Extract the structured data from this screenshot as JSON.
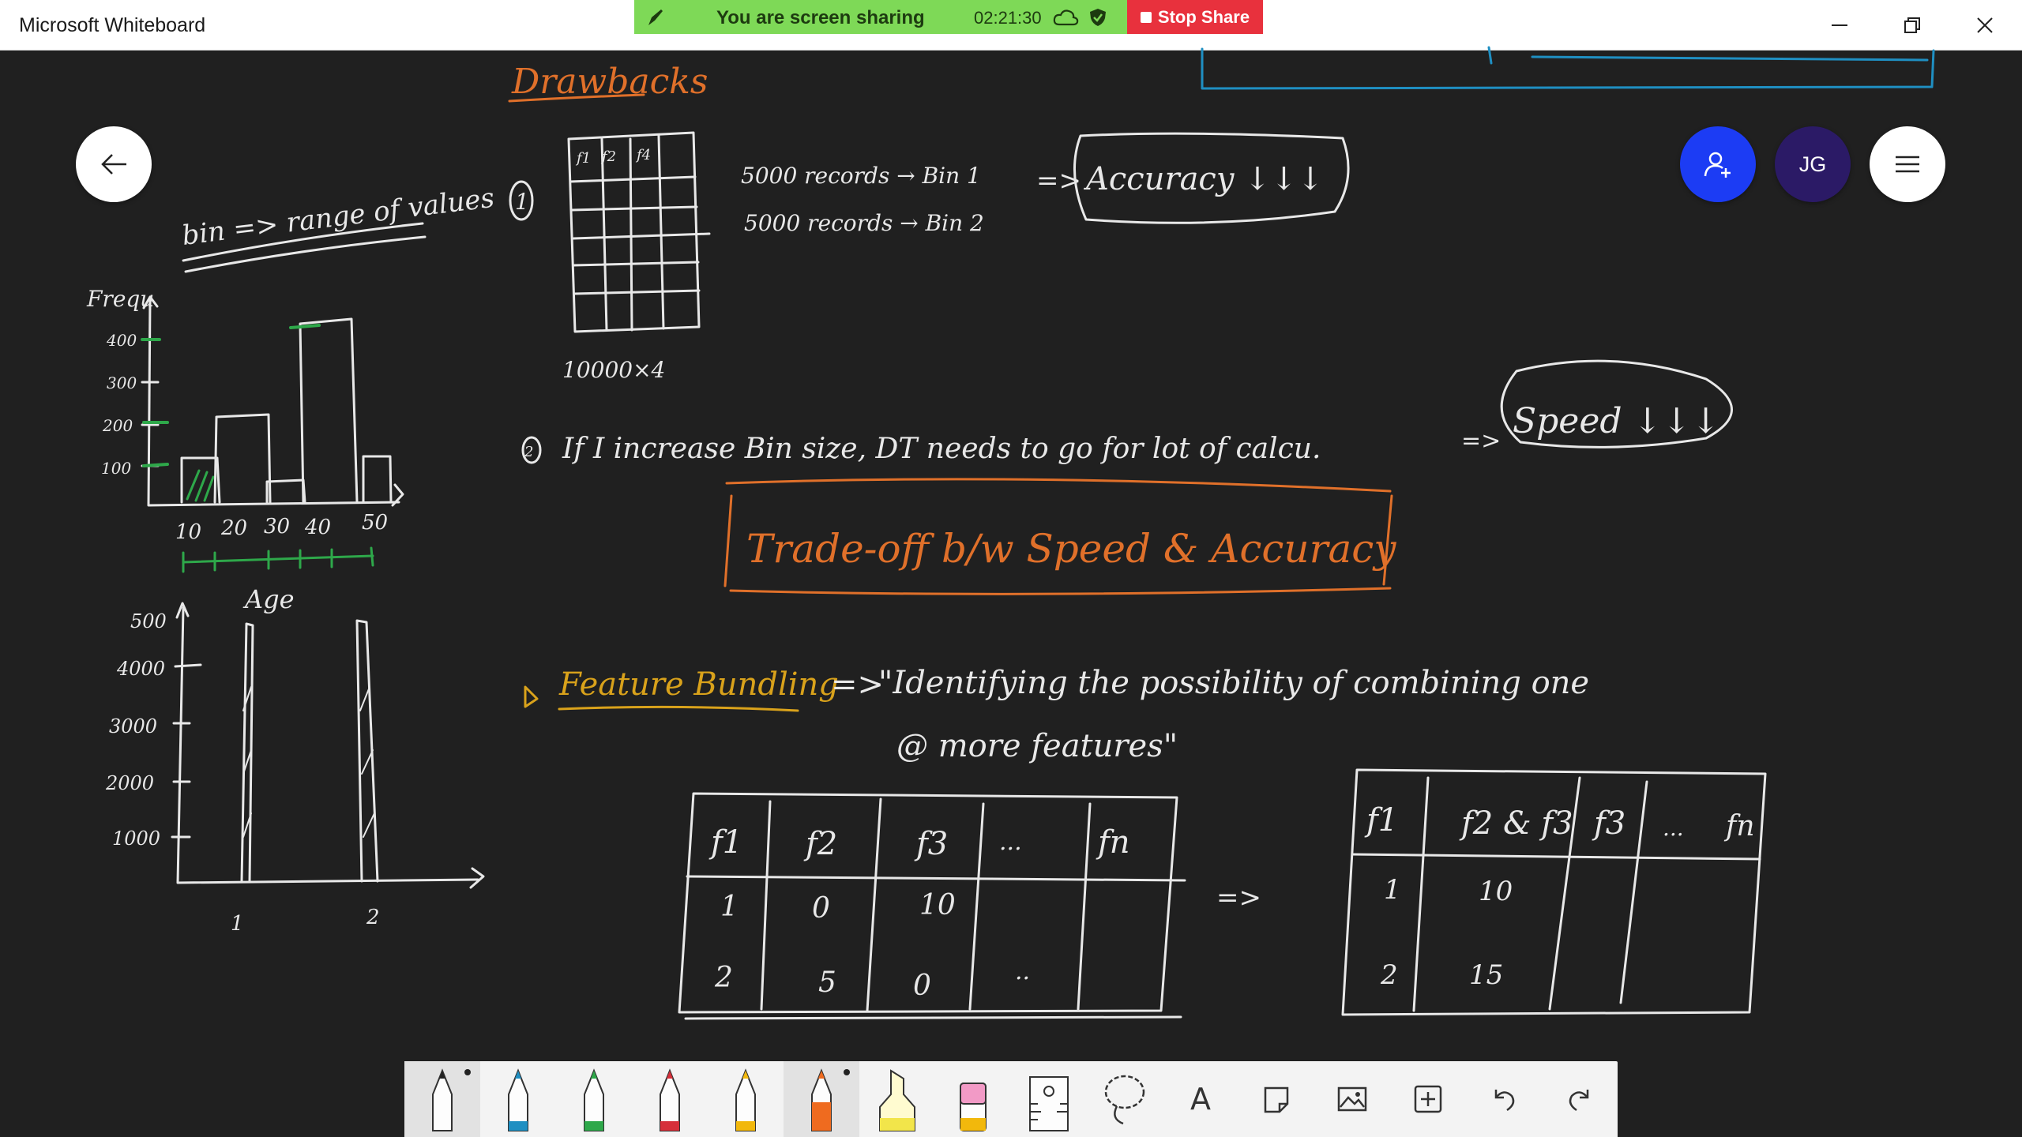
{
  "window": {
    "title": "Microsoft Whiteboard",
    "controls": [
      "minimize",
      "restore",
      "close"
    ]
  },
  "share_banner": {
    "text": "You are screen sharing",
    "elapsed": "02:21:30",
    "stop_label": "Stop Share",
    "colors": {
      "banner": "#7ed957",
      "stop": "#e8313d"
    }
  },
  "avatar": {
    "initials": "JG"
  },
  "board": {
    "heading": "Drawbacks",
    "bin_note": "bin => range of values",
    "hist1": {
      "ylabel": "Frequ",
      "y_ticks": [
        "400",
        "300",
        "200",
        "100"
      ],
      "x_ticks": [
        "10",
        "20",
        "30",
        "40",
        "50"
      ],
      "xlabel": "Age"
    },
    "hist2": {
      "y_ticks": [
        "500",
        "4000",
        "3000",
        "2000",
        "1000"
      ],
      "x_ticks": [
        "1",
        "2"
      ]
    },
    "point1": {
      "number": "1",
      "line1": "5000 records → Bin 1",
      "line2": "5000 records → Bin 2",
      "arrow": "=>",
      "result": "Accuracy ↓↓↓",
      "table_size": "10000×4",
      "mini_headers": [
        "f1",
        "f2",
        "f4"
      ]
    },
    "point2": {
      "number": "2",
      "text": "If I increase Bin size, DT needs to go for lot of calcu.",
      "arrow": "=>",
      "result": "Speed ↓↓↓"
    },
    "tradeoff": "Trade-off b/w Speed & Accuracy",
    "feature_bundling": {
      "label": "Feature Bundling",
      "arrow": "=>",
      "def_line1": "\"Identifying the possibility of combining one",
      "def_line2": "@ more features\""
    },
    "table_left": {
      "headers": [
        "f1",
        "f2",
        "f3",
        "...",
        "fn"
      ],
      "rows": [
        [
          "1",
          "0",
          "10",
          "",
          ""
        ],
        [
          "2",
          "5",
          "0",
          "..",
          ""
        ]
      ]
    },
    "table_arrow": "=>",
    "table_right": {
      "headers": [
        "f1",
        "f2 & f3",
        "f3",
        "...",
        "fn"
      ],
      "rows": [
        [
          "1",
          "10",
          "",
          "",
          ""
        ],
        [
          "2",
          "15",
          "",
          "",
          ""
        ]
      ]
    }
  },
  "ink_colors": {
    "white": "#e8e8e8",
    "orange": "#e0702a",
    "yellow": "#d9a21b",
    "blue": "#1f8fc2",
    "green": "#2ea84a"
  },
  "toolbar": {
    "tools": [
      "pen-black",
      "pen-blue",
      "pen-green",
      "pen-red",
      "pen-yellow",
      "pen-orange",
      "highlighter",
      "eraser",
      "ruler",
      "lasso",
      "text",
      "note",
      "image",
      "insert",
      "undo",
      "redo"
    ],
    "text_tool_glyph": "A"
  }
}
